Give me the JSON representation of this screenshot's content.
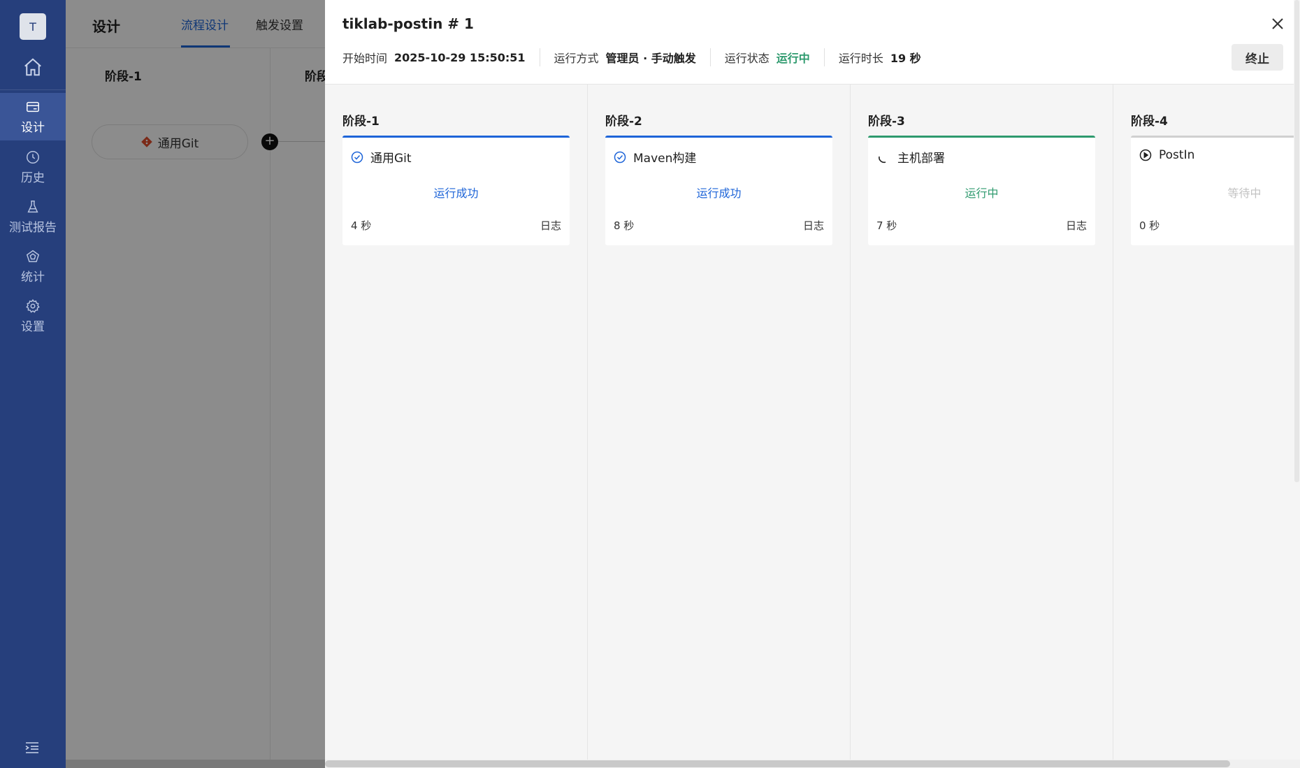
{
  "sidebar": {
    "avatar": "T",
    "items": [
      {
        "label": "设计"
      },
      {
        "label": "历史"
      },
      {
        "label": "测试报告"
      },
      {
        "label": "统计"
      },
      {
        "label": "设置"
      }
    ]
  },
  "background": {
    "title": "设计",
    "tabs": [
      {
        "label": "流程设计"
      },
      {
        "label": "触发设置"
      }
    ],
    "stages": [
      {
        "label": "阶段-1"
      },
      {
        "label": "阶段"
      }
    ],
    "task": "通用Git",
    "add": "+"
  },
  "drawer": {
    "title": "tiklab-postin # 1",
    "meta": {
      "start_label": "开始时间",
      "start_value": "2025-10-29 15:50:51",
      "mode_label": "运行方式",
      "mode_value": "管理员 · 手动触发",
      "status_label": "运行状态",
      "status_value": "运行中",
      "duration_label": "运行时长",
      "duration_value": "19 秒"
    },
    "stop_label": "终止",
    "stages": [
      {
        "name": "阶段-1",
        "task": "通用Git",
        "status": "运行成功",
        "time": "4 秒",
        "log": "日志"
      },
      {
        "name": "阶段-2",
        "task": "Maven构建",
        "status": "运行成功",
        "time": "8 秒",
        "log": "日志"
      },
      {
        "name": "阶段-3",
        "task": "主机部署",
        "status": "运行中",
        "time": "7 秒",
        "log": "日志"
      },
      {
        "name": "阶段-4",
        "task": "PostIn",
        "status": "等待中",
        "time": "0 秒"
      }
    ]
  },
  "colors": {
    "sidebar": "#263f7c",
    "primary": "#1d64d8",
    "running": "#2e9a6e"
  }
}
